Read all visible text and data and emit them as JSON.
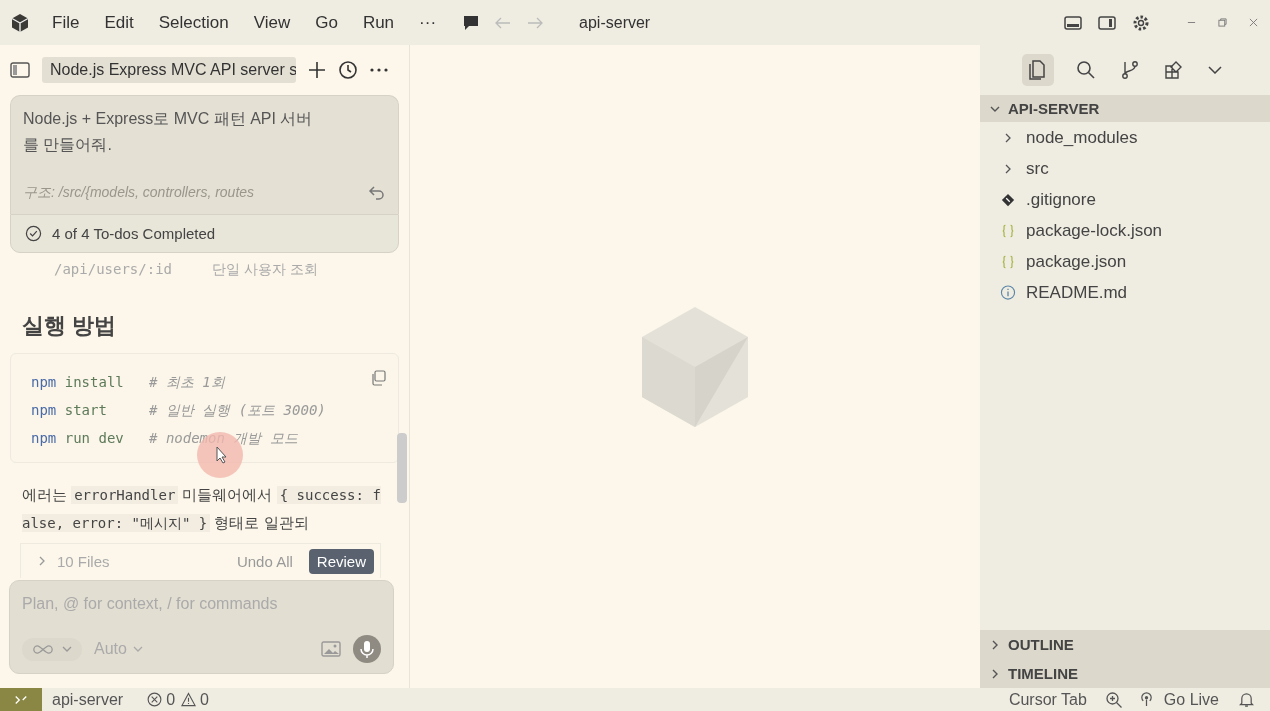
{
  "menu": [
    "File",
    "Edit",
    "Selection",
    "View",
    "Go",
    "Run",
    "···"
  ],
  "window": {
    "title": "api-server"
  },
  "chat": {
    "tab": "Node.js Express MVC API server s",
    "user_message": {
      "lines": [
        "Node.js + Express로 MVC 패턴 API 서버",
        "를 만들어줘."
      ],
      "faded": "구조: /src/{models, controllers, routes"
    },
    "todos": {
      "label": "4 of 4 To-dos Completed",
      "done": true
    },
    "hidden_row": {
      "path": "/api/users/:id",
      "desc": "단일 사용자 조회"
    },
    "heading": "실행 방법",
    "code": [
      {
        "cmd": "npm",
        "args": "install  ",
        "comment": "# 최초 1회"
      },
      {
        "cmd": "npm",
        "args": "start    ",
        "comment": "# 일반 실행 (포트 3000)"
      },
      {
        "cmd": "npm",
        "args": "run dev  ",
        "comment": "# nodemon 개발 모드"
      }
    ],
    "paragraph": [
      {
        "text": "에러는 ",
        "code": false
      },
      {
        "text": "errorHandler",
        "code": true
      },
      {
        "text": " 미들웨어에서 ",
        "code": false
      },
      {
        "text": "{ success: false, error: \"메시지\" }",
        "code": true
      },
      {
        "text": " 형태로 일관되",
        "code": false
      }
    ],
    "files": {
      "label": "10 Files",
      "expanded": false,
      "undo": "Undo All",
      "review": "Review"
    },
    "composer": {
      "placeholder": "Plan, @ for context, / for commands",
      "model": "Auto"
    }
  },
  "explorer": {
    "title": "API-SERVER",
    "expanded": true,
    "items": [
      {
        "kind": "folder",
        "name": "node_modules",
        "expanded": false
      },
      {
        "kind": "folder",
        "name": "src",
        "expanded": false
      },
      {
        "kind": "git",
        "name": ".gitignore"
      },
      {
        "kind": "json",
        "name": "package-lock.json"
      },
      {
        "kind": "json",
        "name": "package.json"
      },
      {
        "kind": "info",
        "name": "README.md"
      }
    ],
    "sections": [
      {
        "label": "OUTLINE",
        "expanded": false
      },
      {
        "label": "TIMELINE",
        "expanded": false
      }
    ]
  },
  "status_bar": {
    "branch": "api-server",
    "errors": "0",
    "warnings": "0",
    "items": [
      "Cursor Tab",
      "Go Live"
    ]
  }
}
